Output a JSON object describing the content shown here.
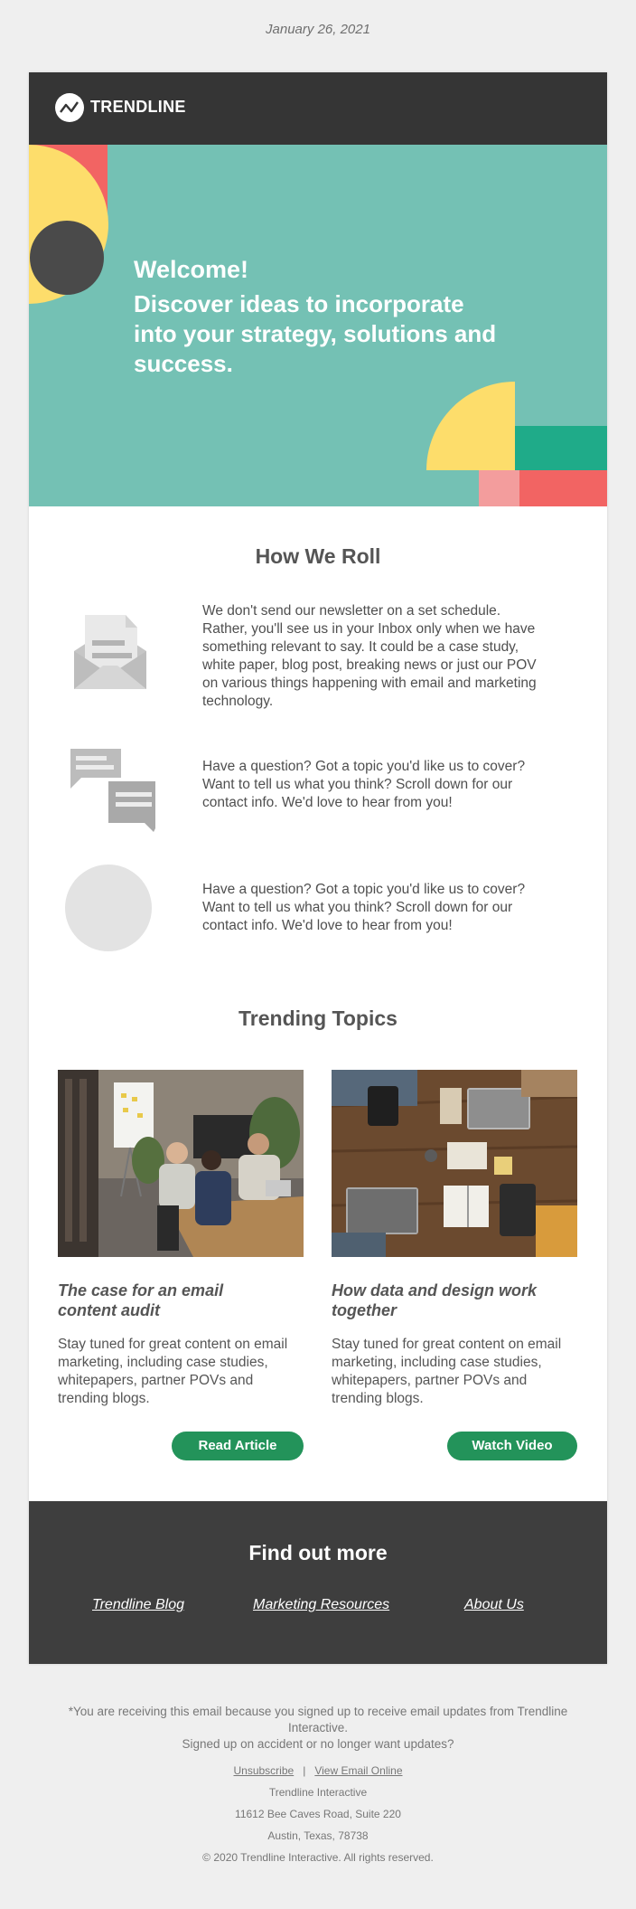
{
  "date": "January 26, 2021",
  "brand": {
    "name": "TRENDLINE"
  },
  "hero": {
    "welcome": "Welcome!",
    "subtitle": "Discover ideas to incorporate into your strategy, solutions and success."
  },
  "how_we_roll": {
    "title": "How We Roll",
    "features": [
      {
        "icon": "envelope-icon",
        "text": "We don't send our newsletter on a set schedule. Rather, you'll see us in your Inbox only when we have something relevant to say. It could be a case study, white paper, blog post, breaking news or just our POV on various things happening with email and marketing technology."
      },
      {
        "icon": "chat-bubbles-icon",
        "text": "Have a question? Got a topic you'd like us to cover? Want to tell us what you think? Scroll down for our contact info. We'd love to hear from you!"
      },
      {
        "icon": "circle-placeholder-icon",
        "text": "Have a question? Got a topic you'd like us to cover? Want to tell us what you think? Scroll down for our contact info. We'd love to hear from you!"
      }
    ]
  },
  "trending": {
    "title": "Trending Topics",
    "articles": [
      {
        "title": "The case for an email content audit",
        "description": "Stay tuned for great content on email marketing, including case studies, whitepapers, partner POVs and trending blogs.",
        "button": "Read Article"
      },
      {
        "title": "How data and design work together",
        "description": "Stay tuned for great content on email marketing, including case studies, whitepapers, partner POVs and trending blogs.",
        "button": "Watch Video"
      }
    ]
  },
  "footer": {
    "title": "Find out more",
    "links": [
      "Trendline Blog",
      "Marketing Resources",
      "About Us"
    ]
  },
  "legal": {
    "notice": "*You are receiving this email because you signed up to receive email updates from Trendline Interactive.",
    "question": "Signed up on accident or no longer want updates?",
    "unsubscribe": "Unsubscribe",
    "separator": "|",
    "view_online": "View Email Online",
    "company": "Trendline Interactive",
    "address1": "11612 Bee Caves Road, Suite 220",
    "address2": "Austin, Texas, 78738",
    "copyright": "© 2020 Trendline Interactive. All rights reserved."
  },
  "colors": {
    "hero_teal": "#74c1b4",
    "accent_yellow": "#fddd6b",
    "accent_coral": "#f26463",
    "accent_green": "#1fab89",
    "button_green": "#23935a",
    "dark_band": "#3e3e3e"
  }
}
